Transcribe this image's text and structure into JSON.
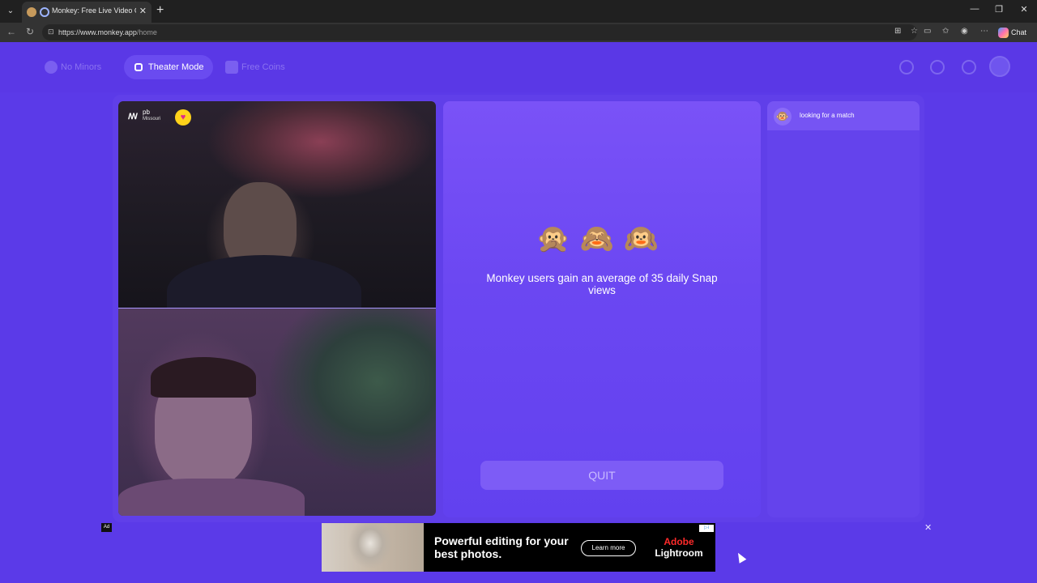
{
  "browser": {
    "tab_title": "Monkey: Free Live Video Chat",
    "tab_close": "✕",
    "tab_new": "+",
    "url_host": "https://www.monkey.app",
    "url_path": "/home",
    "chat_label": "Chat",
    "window_controls": [
      "—",
      "❐",
      "✕"
    ]
  },
  "nav": {
    "no_minors": "No Minors",
    "theater_mode": "Theater Mode",
    "free_coins": "Free Coins"
  },
  "video": {
    "partner_name": "pb",
    "partner_location": "Missouri",
    "partner_logo": "ꟿ",
    "badge_icon": "heart-icon"
  },
  "main": {
    "monkeys": [
      "🙊",
      "🙈",
      "🙉"
    ],
    "message": "Monkey users gain an average of 35 daily Snap views",
    "quit_label": "QUIT"
  },
  "chat": {
    "status": "looking for a match",
    "avatar": "🐵"
  },
  "ad": {
    "label": "Ad",
    "headline": "Powerful editing for your best photos.",
    "cta": "Learn more",
    "brand_line1": "Adobe",
    "brand_line2": "Lightroom",
    "close": "✕"
  }
}
